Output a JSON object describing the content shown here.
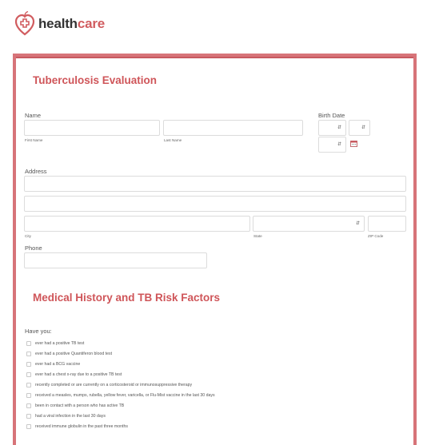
{
  "brand": {
    "name_part1": "health",
    "name_part2": "care",
    "accent": "#d15c5f"
  },
  "form": {
    "title": "Tuberculosis Evaluation",
    "name": {
      "label": "Name",
      "first_sub": "First Name",
      "last_sub": "Last Name"
    },
    "birth_date": {
      "label": "Birth Date"
    },
    "address": {
      "label": "Address",
      "city_sub": "City",
      "state_sub": "State",
      "zip_sub": "ZIP Code"
    },
    "phone": {
      "label": "Phone"
    },
    "section2_title": "Medical History and TB Risk Factors",
    "have_you": "Have you:",
    "risk_factors": [
      "ever had a positive TB test",
      "ever had a positive Quantiferon blood test",
      "ever had a BCG vaccine",
      "ever had a chest x-ray due to a positive TB test",
      "recently completed or are currently on a corticosteroid or immunosuppressive therapy",
      "received a measles, mumps, rubella, yellow fever, varicella, or Flu-Mist vaccine in the last 30 days",
      "been in contact with a person who has active TB",
      "had a viral infection in the last 30 days",
      "received immune globulin in the past three months"
    ]
  },
  "icons": {
    "logo": "heart-cross-icon",
    "select_arrow": "chevron-updown-icon",
    "calendar": "calendar-icon"
  },
  "colors": {
    "border": "#d77479",
    "heading": "#cf5559"
  }
}
